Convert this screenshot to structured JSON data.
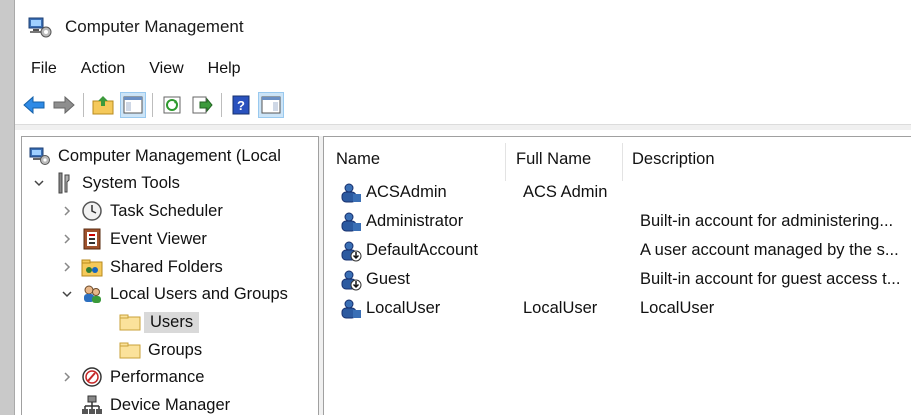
{
  "window": {
    "title": "Computer Management"
  },
  "menu": {
    "items": [
      "File",
      "Action",
      "View",
      "Help"
    ]
  },
  "toolbar": {
    "buttons": [
      "back-arrow-icon",
      "forward-arrow-icon",
      "up-folder-icon",
      "show-hide-tree-icon",
      "refresh-icon",
      "export-list-icon",
      "help-icon",
      "action-pane-icon"
    ]
  },
  "tree": {
    "root": "Computer Management (Local",
    "items": [
      {
        "label": "System Tools",
        "level": 1,
        "expanded": true
      },
      {
        "label": "Task Scheduler",
        "level": 2,
        "expanded": false
      },
      {
        "label": "Event Viewer",
        "level": 2,
        "expanded": false
      },
      {
        "label": "Shared Folders",
        "level": 2,
        "expanded": false
      },
      {
        "label": "Local Users and Groups",
        "level": 2,
        "expanded": true
      },
      {
        "label": "Users",
        "level": 3,
        "selected": true
      },
      {
        "label": "Groups",
        "level": 3
      },
      {
        "label": "Performance",
        "level": 2,
        "expanded": false
      },
      {
        "label": "Device Manager",
        "level": 2
      }
    ]
  },
  "list": {
    "columns": [
      "Name",
      "Full Name",
      "Description"
    ],
    "rows": [
      {
        "name": "ACSAdmin",
        "full_name": "ACS Admin",
        "description": "",
        "disabled": false
      },
      {
        "name": "Administrator",
        "full_name": "",
        "description": "Built-in account for administering...",
        "disabled": false
      },
      {
        "name": "DefaultAccount",
        "full_name": "",
        "description": "A user account managed by the s...",
        "disabled": true
      },
      {
        "name": "Guest",
        "full_name": "",
        "description": "Built-in account for guest access t...",
        "disabled": true
      },
      {
        "name": "LocalUser",
        "full_name": "LocalUser",
        "description": "LocalUser",
        "disabled": false
      }
    ]
  },
  "colors": {
    "selection": "#d9d9d9",
    "active_toolbar": "#cce4f7",
    "border": "#a0a0a0"
  }
}
